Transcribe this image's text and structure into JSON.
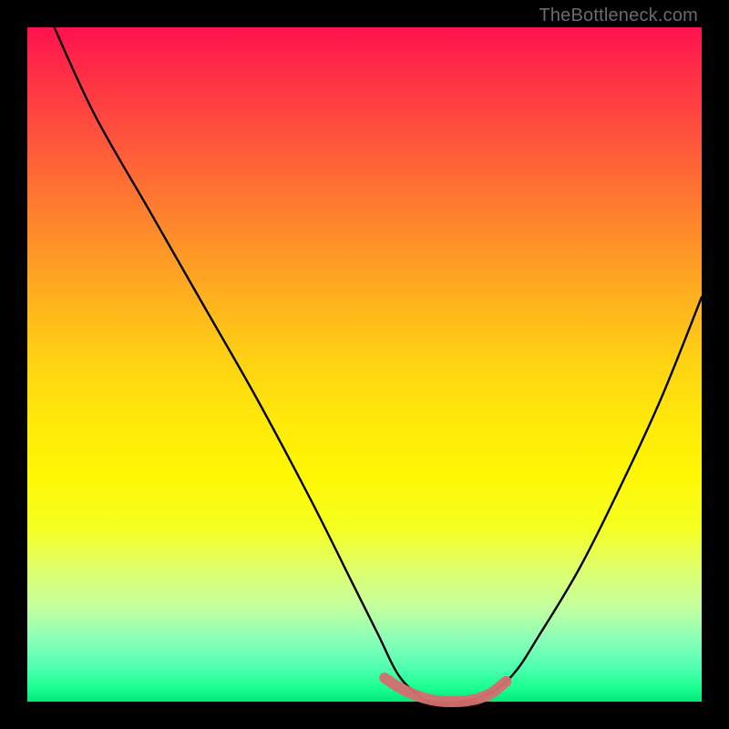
{
  "watermark": "TheBottleneck.com",
  "chart_data": {
    "type": "line",
    "title": "",
    "xlabel": "",
    "ylabel": "",
    "xlim": [
      0,
      100
    ],
    "ylim": [
      0,
      100
    ],
    "series": [
      {
        "name": "bottleneck-curve",
        "color": "#000000",
        "x": [
          4,
          10,
          18,
          26,
          34,
          42,
          48,
          52,
          55,
          58,
          60,
          64,
          68,
          72,
          76,
          82,
          88,
          94,
          100
        ],
        "y": [
          100,
          87,
          73,
          59,
          45,
          30,
          18,
          10,
          4,
          1,
          0,
          0,
          1,
          4,
          10,
          20,
          32,
          45,
          60
        ]
      },
      {
        "name": "optimal-range",
        "color": "#d66e6e",
        "x": [
          53,
          55,
          57,
          59,
          61,
          63,
          65,
          67,
          69,
          71
        ],
        "y": [
          3.5,
          2.2,
          1.2,
          0.5,
          0.1,
          0.0,
          0.1,
          0.5,
          1.4,
          3.0
        ]
      }
    ],
    "x_optimal_range": [
      53,
      71
    ]
  },
  "colors": {
    "background": "#000000",
    "curve": "#000000",
    "optimal_marker": "#d66e6e",
    "watermark": "#6b6b6b"
  }
}
